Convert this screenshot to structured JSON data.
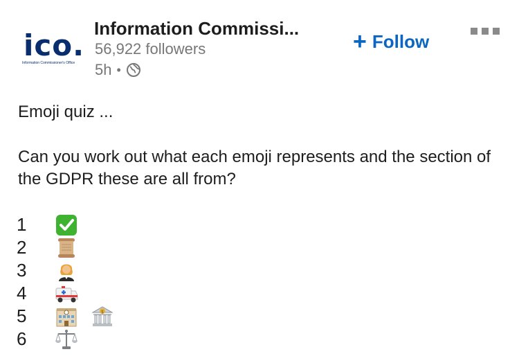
{
  "post": {
    "author": {
      "logo_text": "ico.",
      "logo_subtext": "Information Commissioner's Office",
      "name": "Information Commissi...",
      "followers": "56,922 followers",
      "time": "5h",
      "separator": "•"
    },
    "follow_button": {
      "label": "Follow",
      "icon": "plus-icon"
    },
    "more_button": {
      "icon": "more-horizontal-icon"
    },
    "text_line1": "Emoji quiz ...",
    "text_line2": "Can you work out what each emoji represents and the section of the GDPR these are all from?",
    "items": [
      {
        "number": "1",
        "emojis": [
          "check-mark-button-emoji"
        ]
      },
      {
        "number": "2",
        "emojis": [
          "scroll-emoji"
        ]
      },
      {
        "number": "3",
        "emojis": [
          "judge-emoji"
        ]
      },
      {
        "number": "4",
        "emojis": [
          "ambulance-emoji"
        ]
      },
      {
        "number": "5",
        "emojis": [
          "office-building-emoji",
          "bank-emoji"
        ]
      },
      {
        "number": "6",
        "emojis": [
          "balance-scale-emoji"
        ]
      }
    ]
  },
  "colors": {
    "accent": "#0a66c2",
    "logo": "#0a2d6e",
    "muted_text": "#777777",
    "check_green": "#3fb232"
  }
}
